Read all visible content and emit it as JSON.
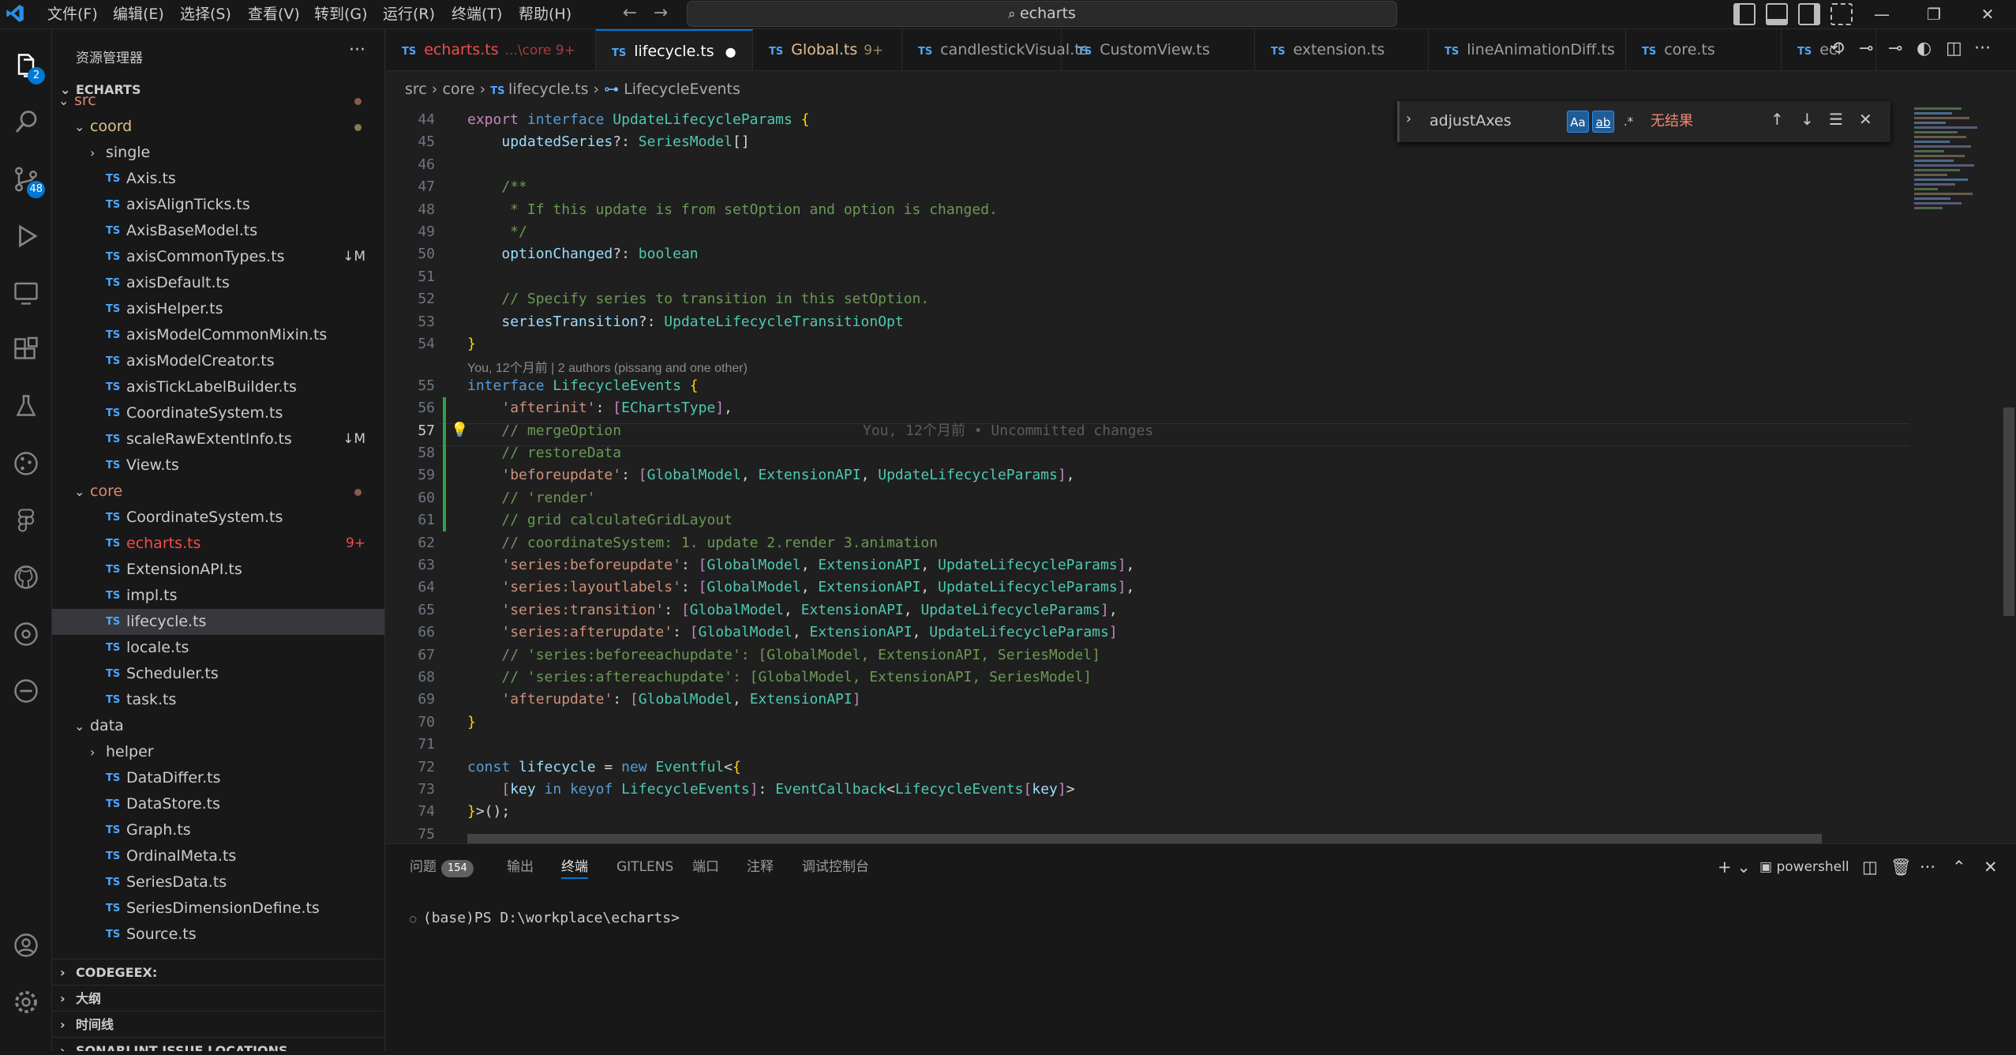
{
  "menu": [
    "文件(F)",
    "编辑(E)",
    "选择(S)",
    "查看(V)",
    "转到(G)",
    "运行(R)",
    "终端(T)",
    "帮助(H)"
  ],
  "search": {
    "text": "echarts"
  },
  "activity": {
    "explorer_badge": "2",
    "scm_badge": "48"
  },
  "sidebar": {
    "title": "资源管理器",
    "root": "ECHARTS",
    "rows": [
      {
        "name": "src",
        "kind": "folder",
        "indent": 1,
        "open": true,
        "color": "#e2856e",
        "dot": true
      },
      {
        "name": "coord",
        "kind": "folder",
        "indent": 2,
        "open": true,
        "color": "#e2c08d",
        "dot": true,
        "dotcolor": "#e2c08d"
      },
      {
        "name": "single",
        "kind": "folder",
        "indent": 3,
        "open": false
      },
      {
        "name": "Axis.ts",
        "kind": "file",
        "indent": 3
      },
      {
        "name": "axisAlignTicks.ts",
        "kind": "file",
        "indent": 3
      },
      {
        "name": "AxisBaseModel.ts",
        "kind": "file",
        "indent": 3
      },
      {
        "name": "axisCommonTypes.ts",
        "kind": "file",
        "indent": 3,
        "status": "↓M"
      },
      {
        "name": "axisDefault.ts",
        "kind": "file",
        "indent": 3
      },
      {
        "name": "axisHelper.ts",
        "kind": "file",
        "indent": 3
      },
      {
        "name": "axisModelCommonMixin.ts",
        "kind": "file",
        "indent": 3
      },
      {
        "name": "axisModelCreator.ts",
        "kind": "file",
        "indent": 3
      },
      {
        "name": "axisTickLabelBuilder.ts",
        "kind": "file",
        "indent": 3
      },
      {
        "name": "CoordinateSystem.ts",
        "kind": "file",
        "indent": 3
      },
      {
        "name": "scaleRawExtentInfo.ts",
        "kind": "file",
        "indent": 3,
        "status": "↓M"
      },
      {
        "name": "View.ts",
        "kind": "file",
        "indent": 3
      },
      {
        "name": "core",
        "kind": "folder",
        "indent": 2,
        "open": true,
        "color": "#e2856e",
        "dot": true
      },
      {
        "name": "CoordinateSystem.ts",
        "kind": "file",
        "indent": 3
      },
      {
        "name": "echarts.ts",
        "kind": "file",
        "indent": 3,
        "color": "#f14c4c",
        "status": "9+",
        "statuscolor": "#f14c4c"
      },
      {
        "name": "ExtensionAPI.ts",
        "kind": "file",
        "indent": 3
      },
      {
        "name": "impl.ts",
        "kind": "file",
        "indent": 3
      },
      {
        "name": "lifecycle.ts",
        "kind": "file",
        "indent": 3,
        "selected": true
      },
      {
        "name": "locale.ts",
        "kind": "file",
        "indent": 3
      },
      {
        "name": "Scheduler.ts",
        "kind": "file",
        "indent": 3
      },
      {
        "name": "task.ts",
        "kind": "file",
        "indent": 3
      },
      {
        "name": "data",
        "kind": "folder",
        "indent": 2,
        "open": true
      },
      {
        "name": "helper",
        "kind": "folder",
        "indent": 3,
        "open": false
      },
      {
        "name": "DataDiffer.ts",
        "kind": "file",
        "indent": 3
      },
      {
        "name": "DataStore.ts",
        "kind": "file",
        "indent": 3
      },
      {
        "name": "Graph.ts",
        "kind": "file",
        "indent": 3
      },
      {
        "name": "OrdinalMeta.ts",
        "kind": "file",
        "indent": 3
      },
      {
        "name": "SeriesData.ts",
        "kind": "file",
        "indent": 3
      },
      {
        "name": "SeriesDimensionDefine.ts",
        "kind": "file",
        "indent": 3
      },
      {
        "name": "Source.ts",
        "kind": "file",
        "indent": 3
      }
    ],
    "sections": [
      "CODEGEEX:",
      "大纲",
      "时间线",
      "SONARLINT ISSUE LOCATIONS"
    ]
  },
  "tabs": [
    {
      "name": "echarts.ts",
      "extra": "...\\core 9+",
      "color": "#f14c4c"
    },
    {
      "name": "lifecycle.ts",
      "active": true,
      "dirty": "●"
    },
    {
      "name": "Global.ts",
      "extra": "9+",
      "color": "#e2c08d"
    },
    {
      "name": "candlestickVisual.ts"
    },
    {
      "name": "CustomView.ts"
    },
    {
      "name": "extension.ts"
    },
    {
      "name": "lineAnimationDiff.ts"
    },
    {
      "name": "core.ts"
    },
    {
      "name": "ecl"
    }
  ],
  "breadcrumb": {
    "a": "src",
    "b": "core",
    "c": "lifecycle.ts",
    "d": "LifecycleEvents"
  },
  "find": {
    "value": "adjustAxes",
    "result": "无结果",
    "opt1": "Aa",
    "opt2": "ab",
    "opt3": ".*"
  },
  "editor": {
    "lens": "You, 12个月前 | 2 authors (pissang and one other)",
    "blame": "You, 12个月前 • Uncommitted changes",
    "current_line": "57",
    "lines": [
      {
        "n": "44",
        "html": "<span class='m'>export</span> <span class='k'>interface</span> <span class='t'>UpdateLifecycleParams</span> <span class='y'>{</span>"
      },
      {
        "n": "45",
        "html": "    <span class='p'>updatedSeries</span><span class='d'>?: </span><span class='t'>SeriesModel</span><span class='d'>[]</span>"
      },
      {
        "n": "46",
        "html": ""
      },
      {
        "n": "47",
        "html": "    <span class='c'>/**</span>"
      },
      {
        "n": "48",
        "html": "<span class='c'>     * If this update is from setOption and option is changed.</span>"
      },
      {
        "n": "49",
        "html": "<span class='c'>     */</span>"
      },
      {
        "n": "50",
        "html": "    <span class='p'>optionChanged</span><span class='d'>?: </span><span class='t'>boolean</span>"
      },
      {
        "n": "51",
        "html": ""
      },
      {
        "n": "52",
        "html": "    <span class='c'>// Specify series to transition in this setOption.</span>"
      },
      {
        "n": "53",
        "html": "    <span class='p'>seriesTransition</span><span class='d'>?: </span><span class='t'>UpdateLifecycleTransitionOpt</span>"
      },
      {
        "n": "54",
        "html": "<span class='y'>}</span>"
      },
      {
        "n": "55",
        "html": "<span class='k'>interface</span> <span class='t'>LifecycleEvents</span> <span class='y'>{</span>"
      },
      {
        "n": "56",
        "html": "    <span class='s'>'afterinit'</span><span class='d'>: </span><span class='m'>[</span><span class='t'>EChartsType</span><span class='m'>]</span><span class='d'>,</span>"
      },
      {
        "n": "57",
        "html": "    <span class='c'>// mergeOption</span>"
      },
      {
        "n": "58",
        "html": "    <span class='c'>// restoreData</span>"
      },
      {
        "n": "59",
        "html": "    <span class='s'>'beforeupdate'</span><span class='d'>: </span><span class='m'>[</span><span class='t'>GlobalModel</span><span class='d'>, </span><span class='t'>ExtensionAPI</span><span class='d'>, </span><span class='t'>UpdateLifecycleParams</span><span class='m'>]</span><span class='d'>,</span>"
      },
      {
        "n": "60",
        "html": "    <span class='c'>// 'render'</span>"
      },
      {
        "n": "61",
        "html": "    <span class='c'>// grid calculateGridLayout</span>"
      },
      {
        "n": "62",
        "html": "    <span class='c'>// coordinateSystem: 1. update 2.render 3.animation</span>"
      },
      {
        "n": "63",
        "html": "    <span class='s'>'series:beforeupdate'</span><span class='d'>: </span><span class='m'>[</span><span class='t'>GlobalModel</span><span class='d'>, </span><span class='t'>ExtensionAPI</span><span class='d'>, </span><span class='t'>UpdateLifecycleParams</span><span class='m'>]</span><span class='d'>,</span>"
      },
      {
        "n": "64",
        "html": "    <span class='s'>'series:layoutlabels'</span><span class='d'>: </span><span class='m'>[</span><span class='t'>GlobalModel</span><span class='d'>, </span><span class='t'>ExtensionAPI</span><span class='d'>, </span><span class='t'>UpdateLifecycleParams</span><span class='m'>]</span><span class='d'>,</span>"
      },
      {
        "n": "65",
        "html": "    <span class='s'>'series:transition'</span><span class='d'>: </span><span class='m'>[</span><span class='t'>GlobalModel</span><span class='d'>, </span><span class='t'>ExtensionAPI</span><span class='d'>, </span><span class='t'>UpdateLifecycleParams</span><span class='m'>]</span><span class='d'>,</span>"
      },
      {
        "n": "66",
        "html": "    <span class='s'>'series:afterupdate'</span><span class='d'>: </span><span class='m'>[</span><span class='t'>GlobalModel</span><span class='d'>, </span><span class='t'>ExtensionAPI</span><span class='d'>, </span><span class='t'>UpdateLifecycleParams</span><span class='m'>]</span>"
      },
      {
        "n": "67",
        "html": "    <span class='c'>// 'series:beforeeachupdate': [GlobalModel, ExtensionAPI, SeriesModel]</span>"
      },
      {
        "n": "68",
        "html": "    <span class='c'>// 'series:aftereachupdate': [GlobalModel, ExtensionAPI, SeriesModel]</span>"
      },
      {
        "n": "69",
        "html": "    <span class='s'>'afterupdate'</span><span class='d'>: </span><span class='m'>[</span><span class='t'>GlobalModel</span><span class='d'>, </span><span class='t'>ExtensionAPI</span><span class='m'>]</span>"
      },
      {
        "n": "70",
        "html": "<span class='y'>}</span>"
      },
      {
        "n": "71",
        "html": ""
      },
      {
        "n": "72",
        "html": "<span class='k'>const</span> <span class='p'>lifecycle</span> <span class='d'>= </span><span class='k'>new</span> <span class='t'>Eventful</span><span class='d'>&lt;</span><span class='y'>{</span>"
      },
      {
        "n": "73",
        "html": "    <span class='m'>[</span><span class='p'>key</span> <span class='k'>in</span> <span class='k'>keyof</span> <span class='t'>LifecycleEvents</span><span class='m'>]</span><span class='d'>: </span><span class='t'>EventCallback</span><span class='d'>&lt;</span><span class='t'>LifecycleEvents</span><span class='m'>[</span><span class='p'>key</span><span class='m'>]</span><span class='d'>&gt;</span>"
      },
      {
        "n": "74",
        "html": "<span class='y'>}</span><span class='d'>&gt;();</span>"
      },
      {
        "n": "75",
        "html": ""
      }
    ]
  },
  "panel": {
    "tabs": [
      "问题",
      "输出",
      "终端",
      "GITLENS",
      "端口",
      "注释",
      "调试控制台"
    ],
    "problems_count": "154",
    "active": "终端",
    "shell": "powershell",
    "terminal": "(base)PS D:\\workplace\\echarts>"
  }
}
